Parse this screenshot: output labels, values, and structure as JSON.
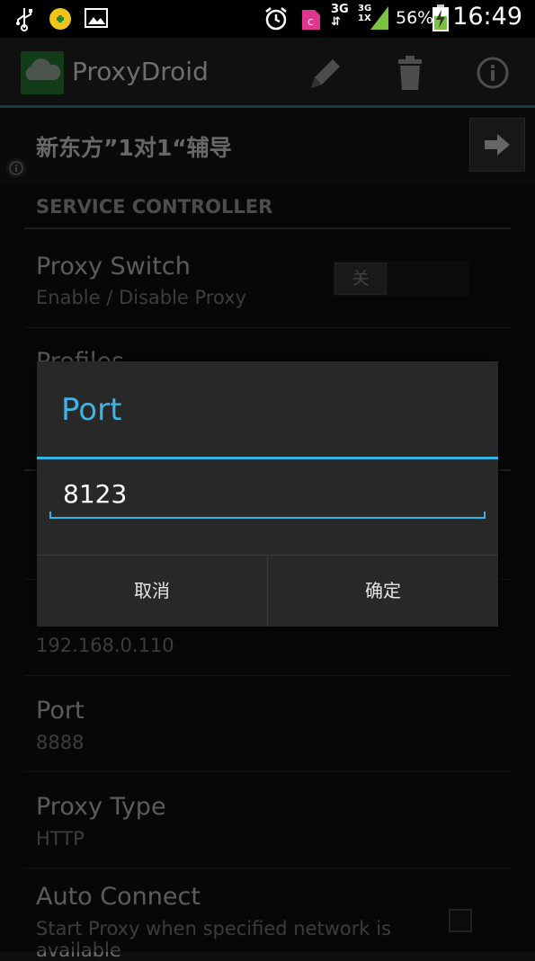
{
  "status_bar": {
    "battery_percent": "56%",
    "network_type": "3G",
    "network_type_2": "3G",
    "network_type_2b": "1X",
    "time": "16:49",
    "icons": [
      "usb-icon",
      "app-notification-icon",
      "image-icon",
      "alarm-icon",
      "sim-c-icon",
      "signal-icon",
      "battery-charging-icon"
    ]
  },
  "action_bar": {
    "app_title": "ProxyDroid",
    "icons": [
      "cloud-app-icon",
      "edit-icon",
      "delete-icon",
      "info-icon"
    ]
  },
  "profile": {
    "name": "新东方”1对1“辅导"
  },
  "settings": {
    "category": "SERVICE CONTROLLER",
    "proxy_switch": {
      "title": "Proxy Switch",
      "subtitle": "Enable / Disable Proxy",
      "toggle_state": "关"
    },
    "profiles": {
      "title": "Profiles"
    },
    "host": {
      "value": "192.168.0.110"
    },
    "port": {
      "title": "Port",
      "value": "8888"
    },
    "proxy_type": {
      "title": "Proxy Type",
      "value": "HTTP"
    },
    "auto_connect": {
      "title": "Auto Connect",
      "subtitle": "Start Proxy when specified network is",
      "subtitle_cont": "available",
      "checked": false
    }
  },
  "dialog": {
    "title": "Port",
    "input_value": "8123",
    "cancel_label": "取消",
    "ok_label": "确定"
  },
  "colors": {
    "accent": "#33b5e5",
    "dialog_bg": "#282828",
    "background": "#0e0e0e"
  }
}
